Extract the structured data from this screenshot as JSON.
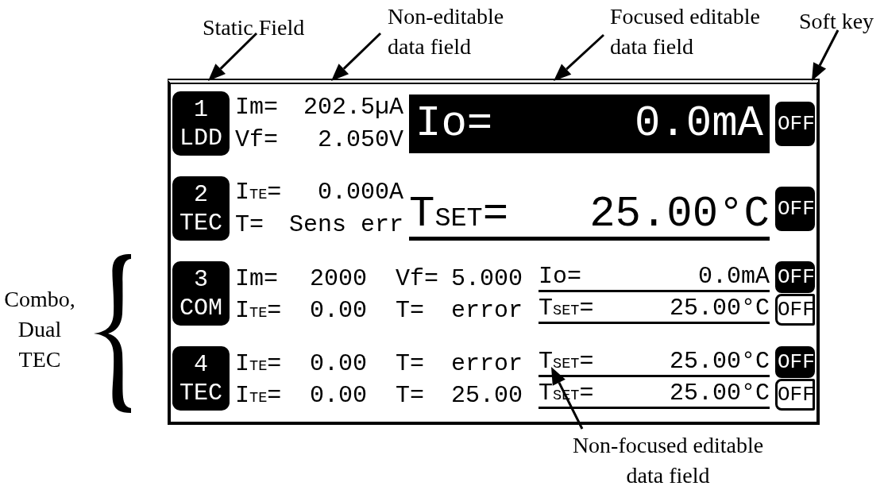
{
  "callouts": [
    {
      "text": "Static Field"
    },
    {
      "text": "Non-editable data field"
    },
    {
      "text": "Focused editable data field"
    },
    {
      "text": "Soft key"
    },
    {
      "text": "Combo, Dual TEC"
    },
    {
      "text": "Non-focused editable data field"
    }
  ],
  "display": {
    "channels": [
      {
        "kind": "single",
        "number": "1",
        "type": "LDD",
        "readings": [
          {
            "label": "Im=",
            "value": "202.5µA"
          },
          {
            "label": "Vf=",
            "value": "2.050V"
          }
        ],
        "setpoint": {
          "label": "Io=",
          "value": "0.0mA",
          "focused": true
        },
        "soft_keys": [
          {
            "label": "OFF",
            "kind": "filled"
          }
        ]
      },
      {
        "kind": "single",
        "number": "2",
        "type": "TEC",
        "readings": [
          {
            "label": "I$_{TE}$=",
            "value": "0.000A"
          },
          {
            "label": "T=",
            "value": "Sens err"
          }
        ],
        "setpoint": {
          "label": "T$_{SET}$=",
          "value": "25.00°C",
          "focused": false
        },
        "soft_keys": [
          {
            "label": "OFF",
            "kind": "filled"
          }
        ]
      },
      {
        "kind": "dual",
        "number": "3",
        "type": "COM",
        "lines": [
          {
            "cells": [
              "Im=",
              "2000",
              "Vf=",
              "5.000"
            ],
            "setpoint": {
              "label": "Io=",
              "value": "0.0mA",
              "focused": false
            }
          },
          {
            "cells": [
              "I$_{TE}$=",
              "0.00",
              "T=",
              "error"
            ],
            "setpoint": {
              "label": "T$_{SET}$=",
              "value": "25.00°C",
              "focused": false
            }
          }
        ],
        "soft_keys": [
          {
            "label": "OFF",
            "kind": "filled"
          },
          {
            "label": "OFF",
            "kind": "outlined"
          }
        ]
      },
      {
        "kind": "dual",
        "number": "4",
        "type": "TEC",
        "lines": [
          {
            "cells": [
              "I$_{TE}$=",
              "0.00",
              "T=",
              "error"
            ],
            "setpoint": {
              "label": "T$_{SET}$=",
              "value": "25.00°C",
              "focused": false
            }
          },
          {
            "cells": [
              "I$_{TE}$=",
              "0.00",
              "T=",
              "25.00"
            ],
            "setpoint": {
              "label": "T$_{SET}$=",
              "value": "25.00°C",
              "focused": false
            }
          }
        ],
        "soft_keys": [
          {
            "label": "OFF",
            "kind": "filled"
          },
          {
            "label": "OFF",
            "kind": "outlined"
          }
        ]
      }
    ]
  }
}
